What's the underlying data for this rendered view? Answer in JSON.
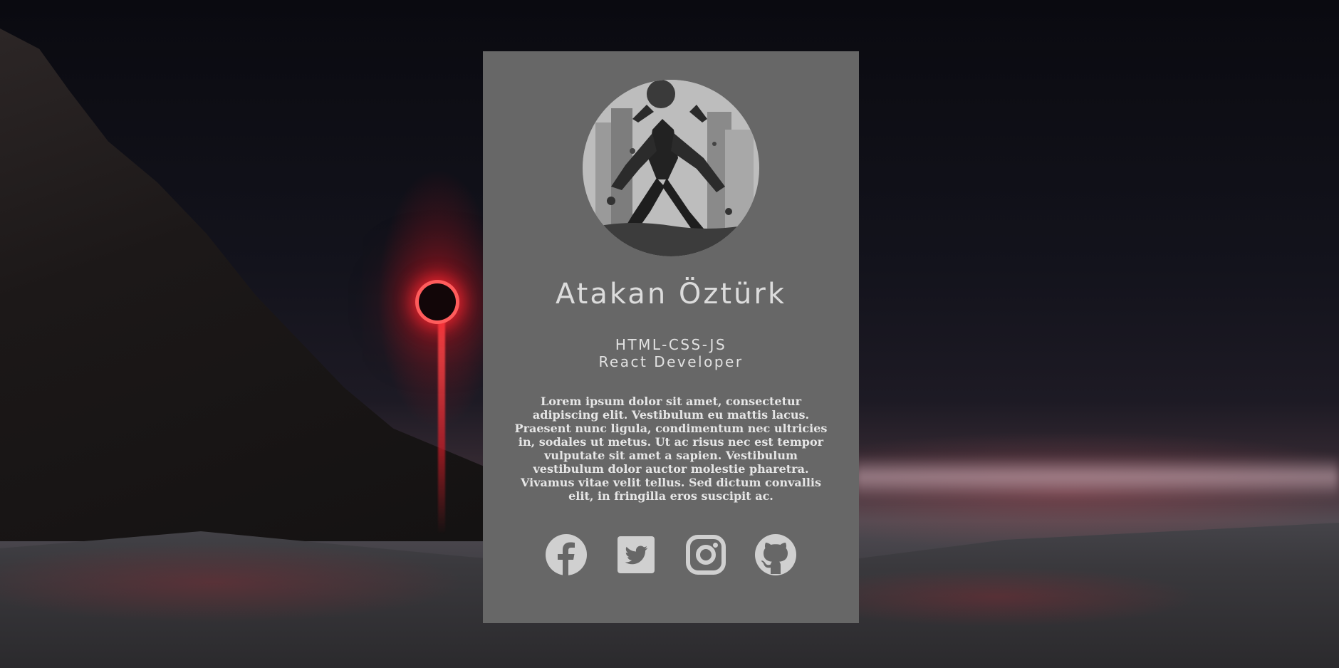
{
  "profile": {
    "name": "Atakan Öztürk",
    "role_line1": "HTML-CSS-JS",
    "role_line2": "React Developer",
    "bio": "Lorem ipsum dolor sit amet, consectetur adipiscing elit. Vestibulum eu mattis lacus. Praesent nunc ligula, condimentum nec ultricies in, sodales ut metus. Ut ac risus nec est tempor vulputate sit amet a sapien. Vestibulum vestibulum dolor auctor molestie pharetra. Vivamus vitae velit tellus. Sed dictum convallis elit, in fringilla eros suscipit ac."
  },
  "socials": [
    {
      "icon": "facebook-icon"
    },
    {
      "icon": "twitter-icon"
    },
    {
      "icon": "instagram-icon"
    },
    {
      "icon": "github-icon"
    }
  ],
  "colors": {
    "card_background": "#676767",
    "icon_color": "#d0d0d0",
    "text_color": "#dcdcdc"
  }
}
